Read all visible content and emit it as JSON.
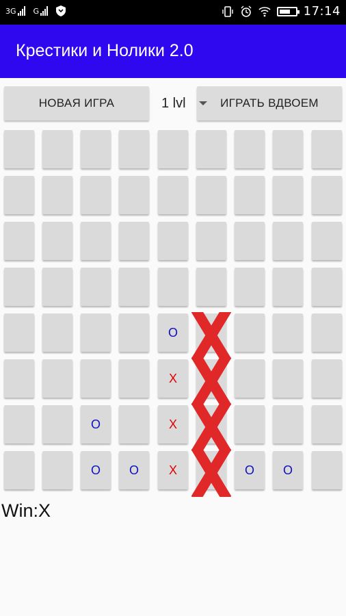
{
  "status_bar": {
    "net1": "3G",
    "net2": "G",
    "time": "17:14"
  },
  "app_bar": {
    "title": "Крестики и Нолики 2.0"
  },
  "controls": {
    "new_game_label": "НОВАЯ ИГРА",
    "level_label": "1 lvl",
    "two_player_label": "ИГРАТЬ ВДВОЕМ"
  },
  "board": {
    "rows": [
      [
        "",
        "",
        "",
        "",
        "",
        "",
        "",
        "",
        ""
      ],
      [
        "",
        "",
        "",
        "",
        "",
        "",
        "",
        "",
        ""
      ],
      [
        "",
        "",
        "",
        "",
        "",
        "",
        "",
        "",
        ""
      ],
      [
        "",
        "",
        "",
        "",
        "",
        "",
        "",
        "",
        ""
      ],
      [
        "",
        "",
        "",
        "",
        "O",
        "X",
        "",
        "",
        ""
      ],
      [
        "",
        "",
        "",
        "",
        "X",
        "X",
        "",
        "",
        ""
      ],
      [
        "",
        "",
        "O",
        "",
        "X",
        "X",
        "",
        "",
        ""
      ],
      [
        "",
        "",
        "O",
        "O",
        "X",
        "X",
        "O",
        "O",
        ""
      ]
    ],
    "winning_column": 5,
    "winning_rows": [
      4,
      5,
      6,
      7
    ]
  },
  "result_text": "Win:X",
  "colors": {
    "app_bar": "#2f08f0",
    "x_mark": "#e00000",
    "o_mark": "#1010c0",
    "win_cross": "#e02828"
  }
}
